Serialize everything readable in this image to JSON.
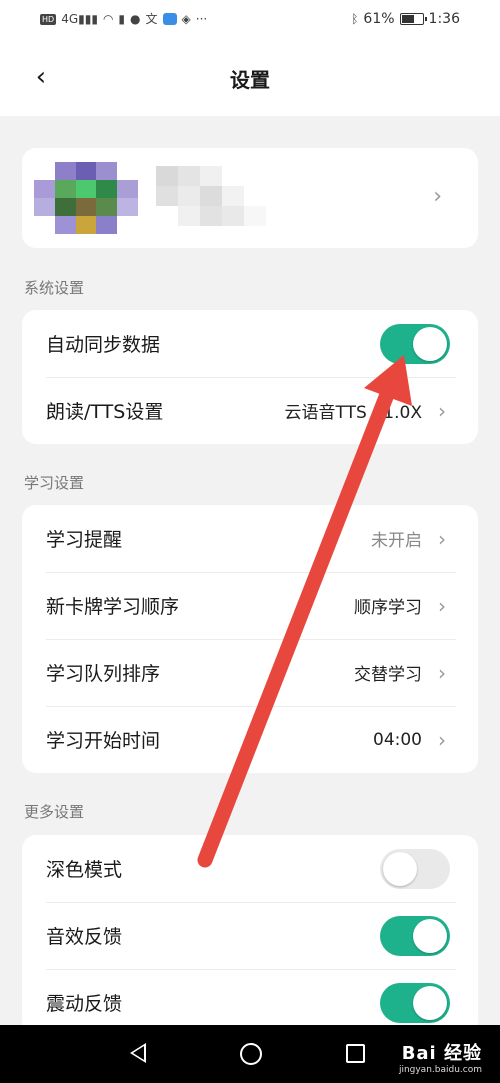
{
  "status_bar": {
    "network_label": "HD",
    "signal_label": "4G",
    "battery_text": "61%",
    "battery_level": 0.61,
    "time": "1:36",
    "icons": [
      "hd-icon",
      "signal-icon",
      "wifi-icon",
      "alert-icon",
      "chat-icon",
      "translate-icon",
      "cloud-icon",
      "shield-icon",
      "more-icon",
      "bluetooth-icon",
      "battery-icon"
    ]
  },
  "header": {
    "title": "设置",
    "back_icon": "back-arrow-icon"
  },
  "profile": {
    "chevron_icon": "chevron-right-icon"
  },
  "sections": {
    "system": {
      "label": "系统设置",
      "auto_sync": {
        "label": "自动同步数据",
        "state": "on"
      },
      "tts": {
        "label": "朗读/TTS设置",
        "value": "云语音TTS / 1.0X"
      }
    },
    "study": {
      "label": "学习设置",
      "reminder": {
        "label": "学习提醒",
        "value": "未开启"
      },
      "new_card_order": {
        "label": "新卡牌学习顺序",
        "value": "顺序学习"
      },
      "queue_order": {
        "label": "学习队列排序",
        "value": "交替学习"
      },
      "start_time": {
        "label": "学习开始时间",
        "value": "04:00"
      }
    },
    "more": {
      "label": "更多设置",
      "dark_mode": {
        "label": "深色模式",
        "state": "off"
      },
      "sound_feedback": {
        "label": "音效反馈",
        "state": "on"
      },
      "vibration_feedback": {
        "label": "震动反馈",
        "state": "on"
      }
    }
  },
  "system_nav": {
    "back_icon": "nav-back-icon",
    "home_icon": "nav-home-icon",
    "recent_icon": "nav-recent-icon"
  },
  "watermark": {
    "title": "Bai 经验",
    "url": "jingyan.baidu.com"
  },
  "colors": {
    "accent": "#1db28c",
    "toggle_off": "#e9e9e9",
    "annotation_arrow": "#e8473d",
    "page_background": "#f2f2f2"
  }
}
